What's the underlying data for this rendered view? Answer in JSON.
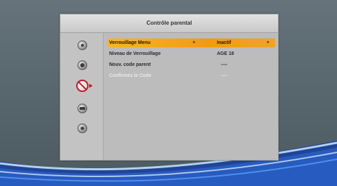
{
  "panel": {
    "title": "Contrôle parental"
  },
  "side_menu": {
    "items": [
      {
        "icon": "disc-icon"
      },
      {
        "icon": "target-icon"
      },
      {
        "icon": "parental-lock-icon",
        "active": true
      },
      {
        "icon": "tv-icon"
      },
      {
        "icon": "settings-gear-icon"
      }
    ]
  },
  "settings": {
    "rows": [
      {
        "label": "Verrouillage Menu",
        "value": "Inactif",
        "arrow_left": "◄",
        "arrow_right": "►",
        "selected": true
      },
      {
        "label": "Niveau de Verrouillage",
        "value": "AGE 18"
      },
      {
        "label": "Nouv. code parent",
        "value": "----"
      },
      {
        "label": "Confirmez le Code",
        "value": "----",
        "disabled": true
      }
    ]
  },
  "colors": {
    "highlight": "#f39a12",
    "active_icon": "#c4162a",
    "panel_bg": "#bcbcbc"
  }
}
